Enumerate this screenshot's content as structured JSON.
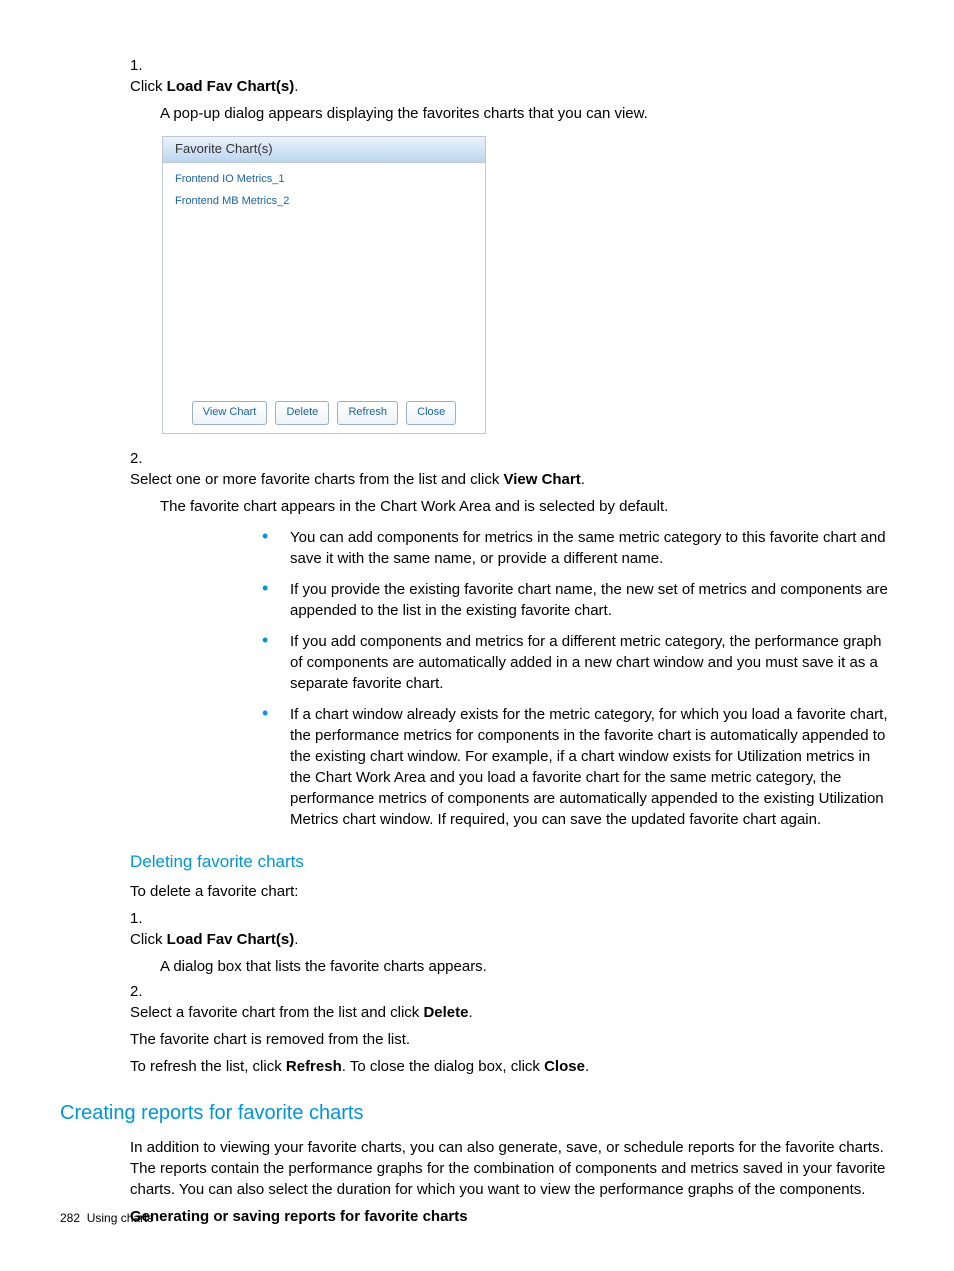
{
  "step1": {
    "num": "1.",
    "text_pre": "Click ",
    "bold": "Load Fav Chart(s)",
    "text_post": ".",
    "sub": "A pop-up dialog appears displaying the favorites charts that you can view."
  },
  "dialog": {
    "header": "Favorite Chart(s)",
    "rows": [
      "Frontend IO Metrics_1",
      "Frontend MB Metrics_2"
    ],
    "buttons": [
      "View Chart",
      "Delete",
      "Refresh",
      "Close"
    ]
  },
  "step2": {
    "num": "2.",
    "text_pre": "Select one or more favorite charts from the list and click ",
    "bold": "View Chart",
    "text_post": ".",
    "sub": "The favorite chart appears in the Chart Work Area and is selected by default.",
    "bullets": [
      "You can add components for metrics in the same metric category to this favorite chart and save it with the same name, or provide a different name.",
      "If you provide the existing favorite chart name, the new set of metrics and components are appended to the list in the existing favorite chart.",
      "If you add components and metrics for a different metric category, the performance graph of components are automatically added in a new chart window and you must save it as a separate favorite chart.",
      "If a chart window already exists for the metric category, for which you load a favorite chart, the performance metrics for components in the favorite chart is automatically appended to the existing chart window. For example, if a chart window exists for Utilization metrics in the Chart Work Area and you load a favorite chart for the same metric category, the performance metrics of components are automatically appended to the existing Utilization Metrics chart window. If required, you can save the updated favorite chart again."
    ]
  },
  "deleting": {
    "heading": "Deleting favorite charts",
    "intro": "To delete a favorite chart:",
    "s1": {
      "num": "1.",
      "text_pre": "Click ",
      "bold": "Load Fav Chart(s)",
      "text_post": ".",
      "sub": "A dialog box that lists the favorite charts appears."
    },
    "s2": {
      "num": "2.",
      "text_pre": "Select a favorite chart from the list and click ",
      "bold": "Delete",
      "text_post": "."
    },
    "after1": "The favorite chart is removed from the list.",
    "after2_pre": "To refresh the list, click ",
    "after2_b1": "Refresh",
    "after2_mid": ". To close the dialog box, click ",
    "after2_b2": "Close",
    "after2_post": "."
  },
  "reports": {
    "heading": "Creating reports for favorite charts",
    "para": "In addition to viewing your favorite charts, you can also generate, save, or schedule reports for the favorite charts. The reports contain the performance graphs for the combination of components and metrics saved in your favorite charts. You can also select the duration for which you want to view the performance graphs of the components.",
    "bold": "Generating or saving reports for favorite charts"
  },
  "footer": {
    "page": "282",
    "title": "Using charts"
  }
}
